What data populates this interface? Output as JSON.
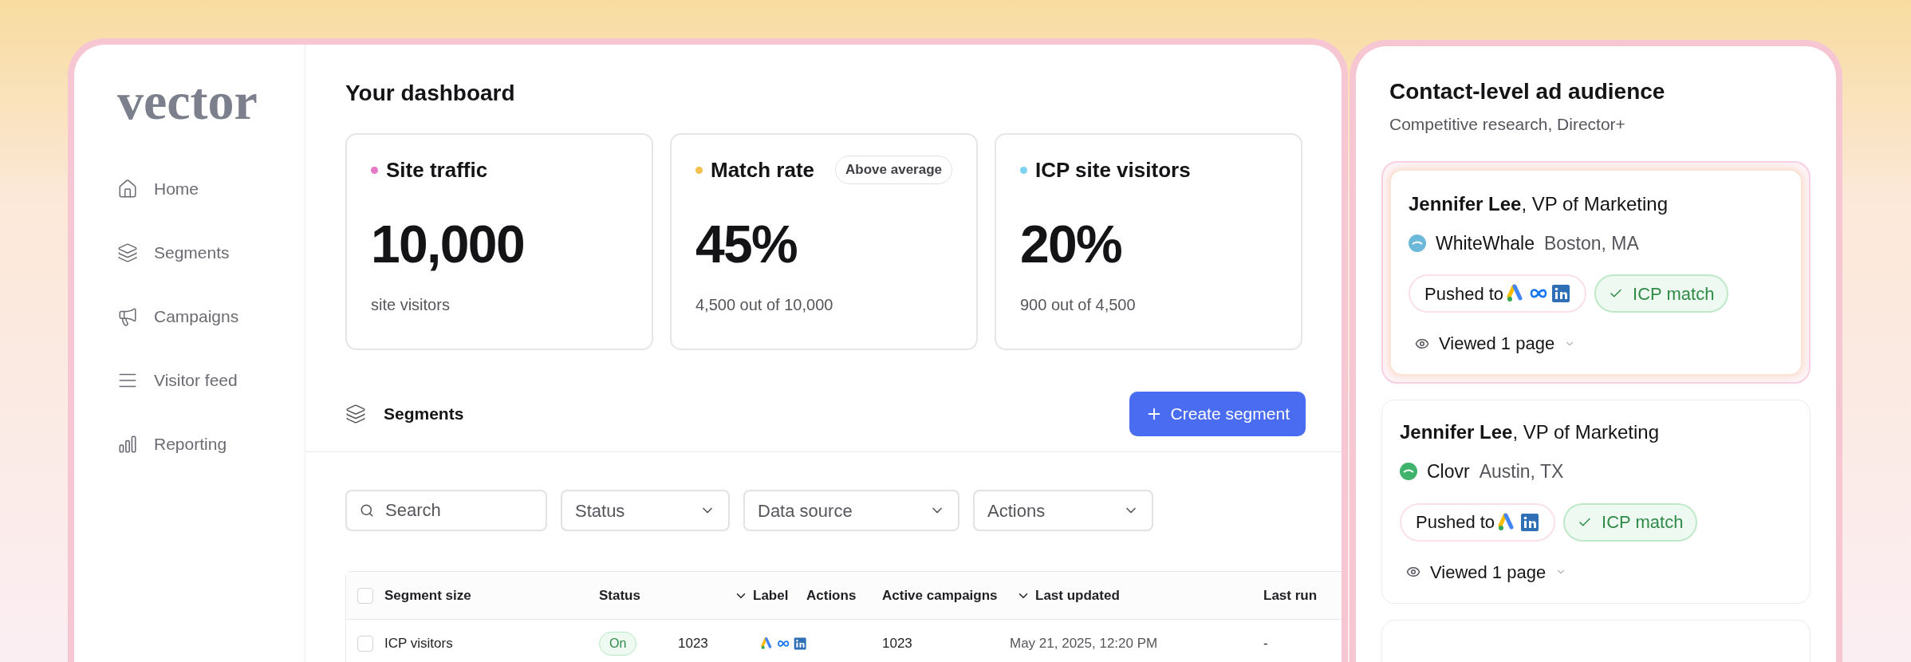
{
  "logo": "vector",
  "nav": [
    {
      "label": "Home"
    },
    {
      "label": "Segments"
    },
    {
      "label": "Campaigns"
    },
    {
      "label": "Visitor feed"
    },
    {
      "label": "Reporting"
    }
  ],
  "title": "Your dashboard",
  "metrics": [
    {
      "title": "Site traffic",
      "color": "#e879c9",
      "value": "10,000",
      "caption": "site visitors"
    },
    {
      "title": "Match rate",
      "color": "#f2c14e",
      "value": "45%",
      "caption": "4,500 out of 10,000",
      "badge": "Above average"
    },
    {
      "title": "ICP site visitors",
      "color": "#7dd3f0",
      "value": "20%",
      "caption": "900 out of 4,500"
    }
  ],
  "segments": {
    "title": "Segments",
    "create_button": "Create segment"
  },
  "filters": {
    "search": {
      "placeholder": "Search"
    },
    "dropdowns": [
      "Status",
      "Data source",
      "Actions"
    ]
  },
  "table": {
    "header_checked": false,
    "columns": [
      {
        "label": "Segment size",
        "sort": false
      },
      {
        "label": "Status",
        "sort": false
      },
      {
        "label": "Label",
        "sort": true
      },
      {
        "label": "Actions",
        "sort": false
      },
      {
        "label": "Active campaigns",
        "sort": false
      },
      {
        "label": "Last updated",
        "sort": true
      },
      {
        "label": "Last run",
        "sort": false
      }
    ],
    "rows": [
      {
        "checked": false,
        "name": "ICP visitors",
        "status": "On",
        "size": "1023",
        "platforms": [
          {
            "kind": "a-logo"
          },
          {
            "kind": "infinity-logo"
          },
          {
            "kind": "in-logo"
          }
        ],
        "active_campaigns": "1023",
        "last_updated": "May 21, 2025, 12:20 PM",
        "last_run": "-"
      }
    ]
  },
  "audience": {
    "title": "Contact-level ad audience",
    "subtitle": "Competitive research, Director+",
    "contacts": [
      {
        "highlighted": true,
        "person": "**Jennifer Lee**, VP of Marketing",
        "company": "WhiteWhale",
        "color": "#6bb8d8",
        "location": "Boston, MA",
        "pushed_label": "Pushed to",
        "platforms": [
          {
            "kind": "a-logo"
          },
          {
            "kind": "infinity-logo"
          },
          {
            "kind": "in-logo"
          }
        ],
        "icp": "ICP match",
        "activity": "Viewed 1 page"
      },
      {
        "highlighted": false,
        "person": "**Jennifer Lee**, VP of Marketing",
        "company": "Clovr",
        "color": "#3fb36b",
        "location": "Austin, TX",
        "pushed_label": "Pushed to",
        "platforms": [
          {
            "kind": "a-logo"
          },
          {
            "kind": "in-logo"
          }
        ],
        "icp": "ICP match",
        "activity": "Viewed 1 page"
      }
    ]
  }
}
